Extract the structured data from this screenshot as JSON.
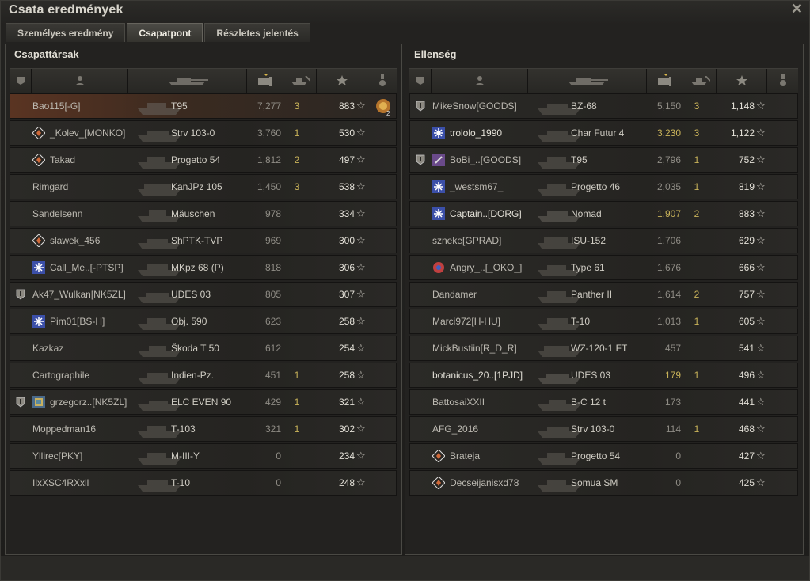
{
  "window": {
    "title": "Csata eredmények"
  },
  "tabs": [
    {
      "label": "Személyes eredmény"
    },
    {
      "label": "Csapatpont"
    },
    {
      "label": "Részletes jelentés"
    }
  ],
  "left": {
    "title": "Csapattársak",
    "rows": [
      {
        "name": "Bao115[-G]",
        "tank": "T95",
        "dmg": "7,277",
        "kills": "3",
        "xp": "883"
      },
      {
        "name": "_Kolev_[MONKO]",
        "tank": "Strv 103-0",
        "dmg": "3,760",
        "kills": "1",
        "xp": "530"
      },
      {
        "name": "Takad",
        "tank": "Progetto 54",
        "dmg": "1,812",
        "kills": "2",
        "xp": "497"
      },
      {
        "name": "Rimgard",
        "tank": "KanJPz 105",
        "dmg": "1,450",
        "kills": "3",
        "xp": "538"
      },
      {
        "name": "Sandelsenn",
        "tank": "Mäuschen",
        "dmg": "978",
        "kills": "",
        "xp": "334"
      },
      {
        "name": "slawek_456",
        "tank": "ShPTK-TVP",
        "dmg": "969",
        "kills": "",
        "xp": "300"
      },
      {
        "name": "Call_Me..[-PTSP]",
        "tank": "MKpz 68 (P)",
        "dmg": "818",
        "kills": "",
        "xp": "306"
      },
      {
        "name": "Ak47_Wulkan[NK5ZL]",
        "tank": "UDES 03",
        "dmg": "805",
        "kills": "",
        "xp": "307"
      },
      {
        "name": "Pim01[BS-H]",
        "tank": "Obj. 590",
        "dmg": "623",
        "kills": "",
        "xp": "258"
      },
      {
        "name": "Kazkaz",
        "tank": "Škoda T 50",
        "dmg": "612",
        "kills": "",
        "xp": "254"
      },
      {
        "name": "Cartographile",
        "tank": "Indien-Pz.",
        "dmg": "451",
        "kills": "1",
        "xp": "258"
      },
      {
        "name": "grzegorz..[NK5ZL]",
        "tank": "ELC EVEN 90",
        "dmg": "429",
        "kills": "1",
        "xp": "321"
      },
      {
        "name": "Moppedman16",
        "tank": "T-103",
        "dmg": "321",
        "kills": "1",
        "xp": "302"
      },
      {
        "name": "Yllirec[PKY]",
        "tank": "M-III-Y",
        "dmg": "0",
        "kills": "",
        "xp": "234"
      },
      {
        "name": "IlxXSC4RXxll",
        "tank": "T-10",
        "dmg": "0",
        "kills": "",
        "xp": "248"
      }
    ],
    "medal_count": "2"
  },
  "right": {
    "title": "Ellenség",
    "rows": [
      {
        "name": "MikeSnow[GOODS]",
        "tank": "BZ-68",
        "dmg": "5,150",
        "kills": "3",
        "xp": "1,148"
      },
      {
        "name": "trololo_1990",
        "tank": "Char Futur 4",
        "dmg": "3,230",
        "kills": "3",
        "xp": "1,122"
      },
      {
        "name": "BoBi_..[GOODS]",
        "tank": "T95",
        "dmg": "2,796",
        "kills": "1",
        "xp": "752"
      },
      {
        "name": "_westsm67_",
        "tank": "Progetto 46",
        "dmg": "2,035",
        "kills": "1",
        "xp": "819"
      },
      {
        "name": "Captain..[DORG]",
        "tank": "Nomad",
        "dmg": "1,907",
        "kills": "2",
        "xp": "883"
      },
      {
        "name": "szneke[GPRAD]",
        "tank": "ISU-152",
        "dmg": "1,706",
        "kills": "",
        "xp": "629"
      },
      {
        "name": "Angry_..[_OKO_]",
        "tank": "Type 61",
        "dmg": "1,676",
        "kills": "",
        "xp": "666"
      },
      {
        "name": "Dandamer",
        "tank": "Panther II",
        "dmg": "1,614",
        "kills": "2",
        "xp": "757"
      },
      {
        "name": "Marci972[H-HU]",
        "tank": "T-10",
        "dmg": "1,013",
        "kills": "1",
        "xp": "605"
      },
      {
        "name": "MickBustiin[R_D_R]",
        "tank": "WZ-120-1 FT",
        "dmg": "457",
        "kills": "",
        "xp": "541"
      },
      {
        "name": "botanicus_20..[1PJD]",
        "tank": "UDES 03",
        "dmg": "179",
        "kills": "1",
        "xp": "496"
      },
      {
        "name": "BattosaiXXII",
        "tank": "B-C 12 t",
        "dmg": "173",
        "kills": "",
        "xp": "441"
      },
      {
        "name": "AFG_2016",
        "tank": "Strv 103-0",
        "dmg": "114",
        "kills": "1",
        "xp": "468"
      },
      {
        "name": "Brateja",
        "tank": "Progetto 54",
        "dmg": "0",
        "kills": "",
        "xp": "427"
      },
      {
        "name": "Decseijanisxd78",
        "tank": "Somua SM",
        "dmg": "0",
        "kills": "",
        "xp": "425"
      }
    ]
  },
  "icons": {
    "star": "☆",
    "close": "✕"
  }
}
